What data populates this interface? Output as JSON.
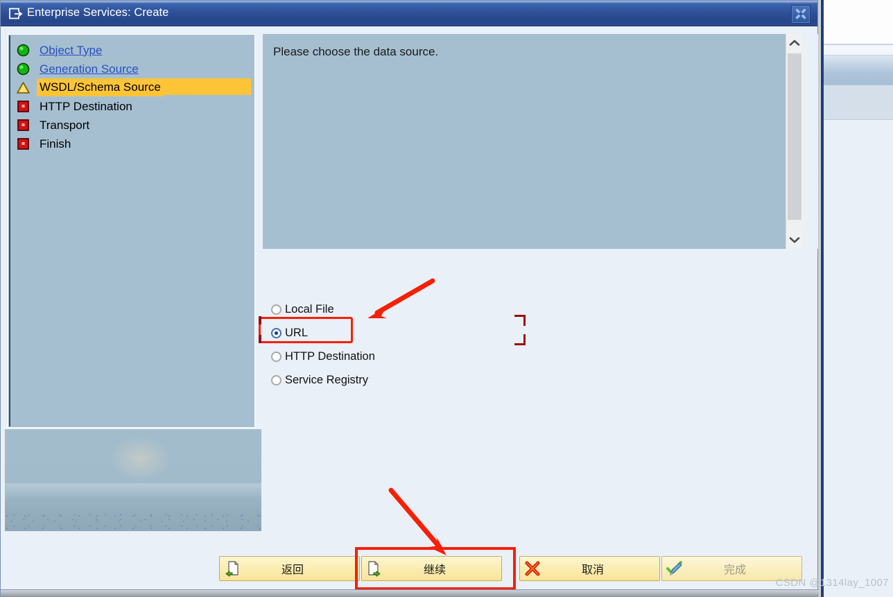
{
  "window": {
    "title": "Enterprise Services: Create",
    "title_icon": "export-window-icon",
    "close_icon": "close-icon"
  },
  "nav": {
    "items": [
      {
        "label": "Object Type",
        "status": "done",
        "icon": "green-circle-icon",
        "is_link": true,
        "current": false
      },
      {
        "label": "Generation Source",
        "status": "done",
        "icon": "green-circle-icon",
        "is_link": true,
        "current": false
      },
      {
        "label": "WSDL/Schema Source",
        "status": "warning",
        "icon": "yellow-triangle-icon",
        "is_link": false,
        "current": true
      },
      {
        "label": "HTTP Destination",
        "status": "pending",
        "icon": "red-square-icon",
        "is_link": false,
        "current": false
      },
      {
        "label": "Transport",
        "status": "pending",
        "icon": "red-square-icon",
        "is_link": false,
        "current": false
      },
      {
        "label": "Finish",
        "status": "pending",
        "icon": "red-square-icon",
        "is_link": false,
        "current": false
      }
    ]
  },
  "instruction": {
    "text": "Please choose the data source."
  },
  "scrollbar": {
    "up_icon": "chevron-up-icon",
    "down_icon": "chevron-down-icon"
  },
  "data_source": {
    "options": [
      {
        "label": "Local File",
        "selected": false
      },
      {
        "label": "URL",
        "selected": true
      },
      {
        "label": "HTTP Destination",
        "selected": false
      },
      {
        "label": "Service Registry",
        "selected": false
      }
    ]
  },
  "buttons": {
    "back": {
      "label": "返回",
      "icon": "doc-back-icon",
      "disabled": false
    },
    "continue": {
      "label": "继续",
      "icon": "doc-forward-icon",
      "disabled": false
    },
    "cancel": {
      "label": "取消",
      "icon": "red-x-icon",
      "disabled": false
    },
    "finish": {
      "label": "完成",
      "icon": "check-pencil-icon",
      "disabled": true
    }
  },
  "watermark": {
    "text": "CSDN @1314lay_1007"
  },
  "colors": {
    "title_bar": "#2d4f95",
    "panel_blue": "#a5bfd0",
    "highlight_yellow": "#fdc437",
    "annotation_red": "#f71f04",
    "corner_mark_red": "#9c0d0d",
    "button_yellow": "#f8e49a",
    "link_blue": "#2a4fc0"
  }
}
